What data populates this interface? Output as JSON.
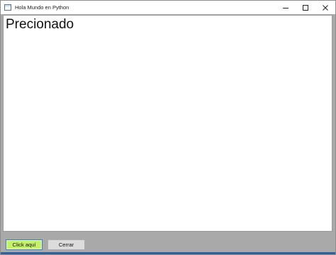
{
  "window": {
    "title": "Hola Mundo en Python",
    "controls": {
      "minimize": "minimize-icon",
      "maximize": "maximize-icon",
      "close": "close-icon"
    }
  },
  "main": {
    "label": "Precionado"
  },
  "buttons": {
    "click_label": "Click aquí",
    "close_label": "Cerrar"
  },
  "colors": {
    "click_button_bg": "#c5f06b",
    "form_bg": "#a9a9a9",
    "content_bg": "#ffffff"
  }
}
